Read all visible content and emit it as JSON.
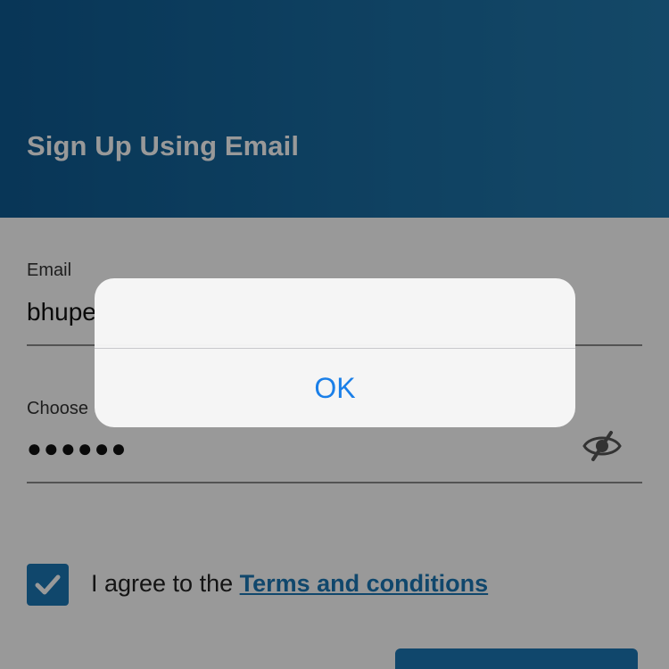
{
  "header": {
    "title": "Sign Up Using Email"
  },
  "form": {
    "email": {
      "label": "Email",
      "value": "bhupe"
    },
    "password": {
      "label": "Choose",
      "value": "●●●●●●",
      "toggle_icon": "eye-slash-icon"
    },
    "agreement": {
      "checked": true,
      "text": "I agree to the ",
      "link_text": "Terms and conditions"
    },
    "submit_button_label": ""
  },
  "alert": {
    "ok_label": "OK"
  },
  "colors": {
    "brand": "#1b77b5",
    "header_start": "#0e5a91",
    "alert_action": "#1a7fe8"
  }
}
